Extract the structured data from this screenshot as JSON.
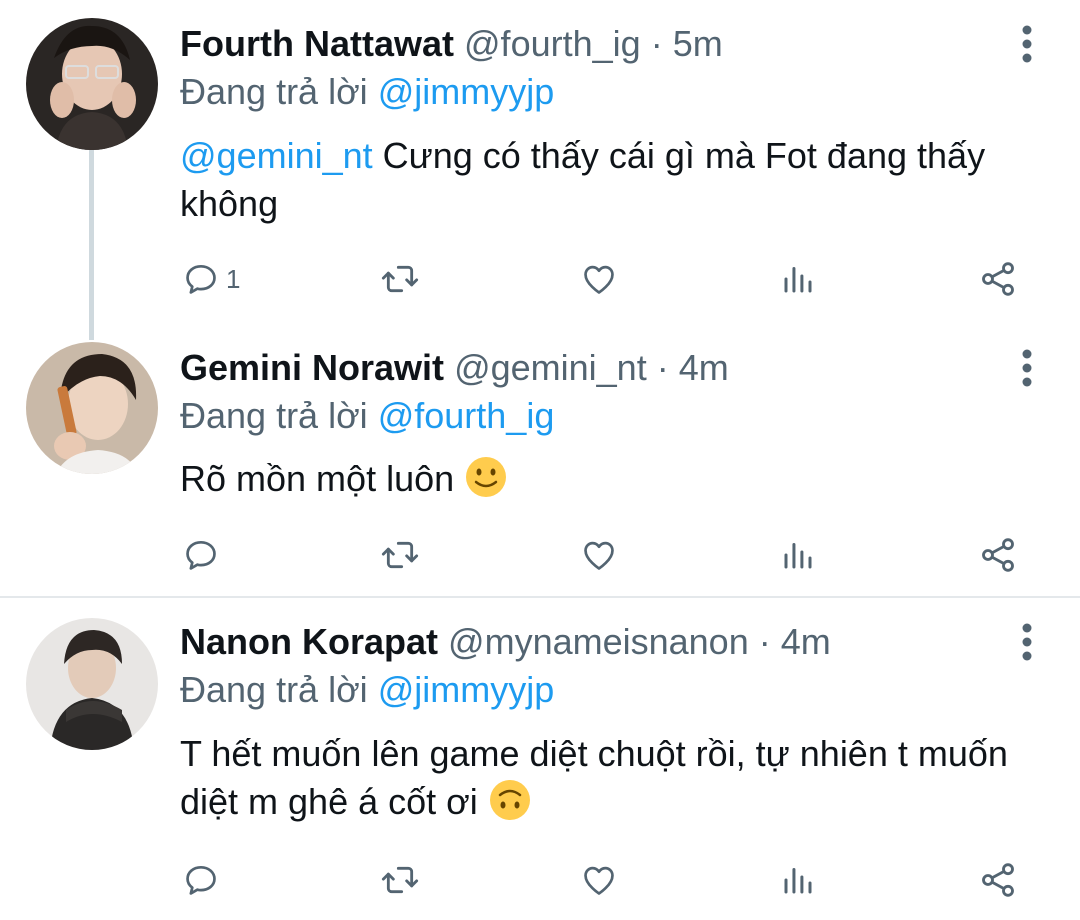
{
  "replying_label": "Đang trả lời",
  "tweets": [
    {
      "name": "Fourth Nattawat",
      "handle": "@fourth_ig",
      "dot": "·",
      "time": "5m",
      "reply_to": "@jimmyyjp",
      "mention": "@gemini_nt",
      "text": " Cưng có thấy cái gì mà Fot đang thấy không",
      "reply_count": "1"
    },
    {
      "name": "Gemini Norawit",
      "handle": "@gemini_nt",
      "dot": "·",
      "time": "4m",
      "reply_to": "@fourth_ig",
      "text": "Rõ mồn một luôn ",
      "emoji": "slightly-smiling-face",
      "reply_count": ""
    },
    {
      "name": "Nanon Korapat",
      "handle": "@mynameisnanon",
      "dot": "·",
      "time": "4m",
      "reply_to": "@jimmyyjp",
      "text": "T hết muốn lên game diệt chuột rồi, tự nhiên t muốn diệt m ghê á cốt ơi ",
      "emoji": "upside-down-face",
      "reply_count": ""
    }
  ],
  "colors": {
    "text": "#0f1419",
    "secondary": "#536471",
    "link": "#1d9bf0",
    "thread_line": "#cfd9de",
    "divider": "#e4e8eb"
  }
}
